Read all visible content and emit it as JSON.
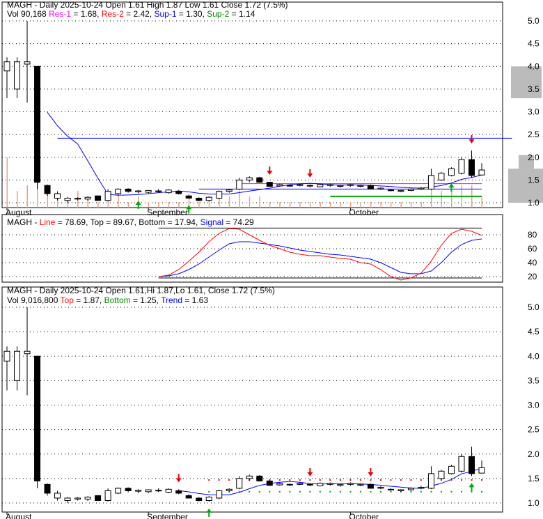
{
  "chart_data": [
    {
      "type": "candlestick",
      "title": "MAGH - Daily 2025-10-24 Open 1.61  High 1.87  Low 1.61  Close 1.72 (7.5%)",
      "legend": {
        "vol": "Vol 90,168",
        "res1": "Res-1",
        "res1_val": " = 1.68, ",
        "res2": "Res-2",
        "res2_val": " = 2.42, ",
        "sup1": "Sup-1",
        "sup1_val": " = 1.30, ",
        "sup2": "Sup-2",
        "sup2_val": " = 1.14"
      },
      "res1": 1.68,
      "res2": 2.42,
      "sup1": 1.3,
      "sup2": 1.14,
      "yticks": [
        1.0,
        1.5,
        2.0,
        2.5,
        3.0,
        3.5,
        4.0,
        4.5,
        5.0
      ],
      "ylim": [
        1.0,
        5.0
      ]
    },
    {
      "type": "line",
      "title_prefix": "MAGH - ",
      "line_label": "Line",
      "line_val": " = 78.69, Top = 89.67, Bottom = 17.94, ",
      "signal_label": "Signal",
      "signal_val": " = 74.29",
      "top": 89.67,
      "bottom": 17.94,
      "yticks": [
        20,
        40,
        60,
        80
      ],
      "ylim": [
        10,
        95
      ]
    },
    {
      "type": "candlestick",
      "title": "MAGH - Daily 2025-10-24 Open 1.61,Hi 1.87,Lo 1.61, Close 1.72 (7.5%)",
      "legend": {
        "vol": "Vol 9,016,800 ",
        "top": "Top",
        "top_val": " = 1.87, ",
        "bottom": "Bottom",
        "bottom_val": " = 1.25, ",
        "trend": "Trend",
        "trend_val": " = 1.63"
      },
      "top": 1.47,
      "bottom": 1.23,
      "yticks": [
        1.0,
        1.5,
        2.0,
        2.5,
        3.0,
        3.5,
        4.0,
        4.5,
        5.0
      ],
      "ylim": [
        1.0,
        5.0
      ]
    }
  ],
  "months": [
    {
      "label": "August",
      "index": 0
    },
    {
      "label": "September",
      "index": 14
    },
    {
      "label": "October",
      "index": 34
    }
  ],
  "ohlc": [
    [
      3.9,
      4.2,
      3.3,
      4.1
    ],
    [
      3.5,
      4.2,
      3.3,
      4.1
    ],
    [
      4.05,
      5.0,
      3.2,
      4.1
    ],
    [
      4.0,
      4.0,
      1.3,
      1.45
    ],
    [
      1.38,
      1.4,
      1.15,
      1.2
    ],
    [
      1.1,
      1.25,
      1.05,
      1.2
    ],
    [
      1.05,
      1.12,
      1.0,
      1.1
    ],
    [
      1.08,
      1.12,
      1.05,
      1.1
    ],
    [
      1.08,
      1.14,
      1.04,
      1.12
    ],
    [
      1.15,
      1.16,
      1.04,
      1.05
    ],
    [
      1.05,
      1.3,
      1.03,
      1.25
    ],
    [
      1.2,
      1.32,
      1.18,
      1.3
    ],
    [
      1.3,
      1.32,
      1.22,
      1.25
    ],
    [
      1.24,
      1.28,
      1.2,
      1.26
    ],
    [
      1.23,
      1.28,
      1.2,
      1.27
    ],
    [
      1.25,
      1.3,
      1.22,
      1.26
    ],
    [
      1.22,
      1.3,
      1.2,
      1.28
    ],
    [
      1.25,
      1.28,
      1.18,
      1.2
    ],
    [
      1.15,
      1.18,
      1.1,
      1.1
    ],
    [
      1.1,
      1.12,
      1.03,
      1.05
    ],
    [
      1.05,
      1.14,
      1.03,
      1.12
    ],
    [
      1.1,
      1.27,
      1.08,
      1.25
    ],
    [
      1.25,
      1.3,
      1.22,
      1.28
    ],
    [
      1.3,
      1.55,
      1.28,
      1.5
    ],
    [
      1.5,
      1.58,
      1.45,
      1.55
    ],
    [
      1.55,
      1.57,
      1.44,
      1.45
    ],
    [
      1.45,
      1.46,
      1.35,
      1.36
    ],
    [
      1.37,
      1.42,
      1.35,
      1.4
    ],
    [
      1.38,
      1.4,
      1.35,
      1.38
    ],
    [
      1.38,
      1.42,
      1.36,
      1.4
    ],
    [
      1.37,
      1.4,
      1.34,
      1.38
    ],
    [
      1.35,
      1.42,
      1.34,
      1.4
    ],
    [
      1.38,
      1.42,
      1.35,
      1.4
    ],
    [
      1.36,
      1.4,
      1.33,
      1.38
    ],
    [
      1.38,
      1.42,
      1.35,
      1.4
    ],
    [
      1.36,
      1.4,
      1.34,
      1.38
    ],
    [
      1.38,
      1.4,
      1.3,
      1.3
    ],
    [
      1.3,
      1.34,
      1.28,
      1.32
    ],
    [
      1.28,
      1.3,
      1.25,
      1.27
    ],
    [
      1.25,
      1.28,
      1.23,
      1.27
    ],
    [
      1.27,
      1.32,
      1.25,
      1.3
    ],
    [
      1.3,
      1.35,
      1.28,
      1.32
    ],
    [
      1.3,
      1.75,
      1.28,
      1.6
    ],
    [
      1.5,
      1.68,
      1.48,
      1.65
    ],
    [
      1.6,
      1.78,
      1.58,
      1.75
    ],
    [
      1.65,
      2.0,
      1.62,
      1.95
    ],
    [
      1.95,
      2.15,
      1.55,
      1.6
    ],
    [
      1.61,
      1.87,
      1.61,
      1.72
    ]
  ],
  "volume": [
    9,
    3,
    4,
    8,
    4,
    2,
    2,
    3,
    2,
    1,
    2,
    3,
    1,
    2,
    1,
    1,
    1,
    1,
    2,
    1,
    2,
    2,
    2,
    3,
    2,
    2,
    1,
    1,
    1,
    1,
    1,
    1,
    1,
    1,
    1,
    1,
    1,
    1,
    1,
    1,
    1,
    1,
    4,
    3,
    3,
    4,
    4,
    2
  ],
  "macd_line": [
    20,
    22,
    30,
    42,
    55,
    70,
    82,
    89,
    88,
    80,
    72,
    65,
    60,
    55,
    52,
    50,
    50,
    48,
    46,
    45,
    40,
    38,
    30,
    20,
    15,
    18,
    25,
    42,
    65,
    82,
    88,
    85,
    79
  ],
  "macd_signal": [
    20,
    21,
    24,
    30,
    38,
    48,
    58,
    67,
    70,
    70,
    68,
    66,
    64,
    61,
    58,
    56,
    54,
    52,
    51,
    49,
    47,
    45,
    40,
    33,
    26,
    24,
    24,
    28,
    40,
    55,
    66,
    72,
    74
  ],
  "sell_arrows": [
    26,
    30,
    46
  ],
  "buy_arrows": [
    13,
    18,
    44
  ],
  "sell_arrows2": [
    17,
    30,
    36
  ],
  "buy_arrows2": [
    20,
    46
  ]
}
